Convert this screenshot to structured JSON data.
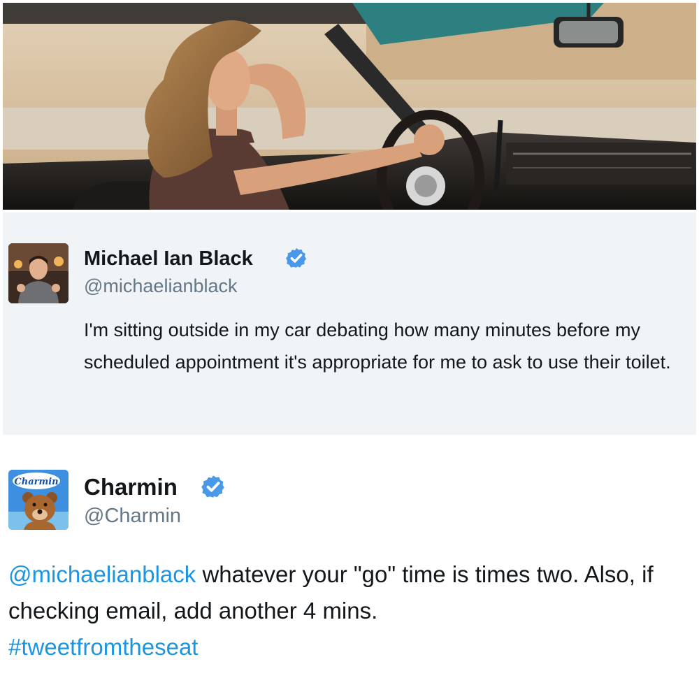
{
  "photo": {
    "description_icon": "woman-driving-car-photo"
  },
  "tweet1": {
    "author_name": "Michael Ian Black",
    "handle": "@michaelianblack",
    "verified_icon": "verified-badge-icon",
    "text": "I'm sitting outside in my car debating how many minutes before my scheduled appointment it's appropriate for me to ask to use their toilet."
  },
  "tweet2": {
    "author_name": "Charmin",
    "handle": "@Charmin",
    "verified_icon": "verified-badge-icon",
    "mention": "@michaelianblack",
    "text": " whatever your \"go\" time is times two. Also, if checking email, add another 4 mins.",
    "hashtag": "#tweetfromtheseat",
    "avatar_logo_text": "Charmin"
  },
  "colors": {
    "verified": "#4a99e9",
    "link": "#1b95e0",
    "tweet1_bg": "#f1f4f7",
    "handle": "#657786"
  }
}
